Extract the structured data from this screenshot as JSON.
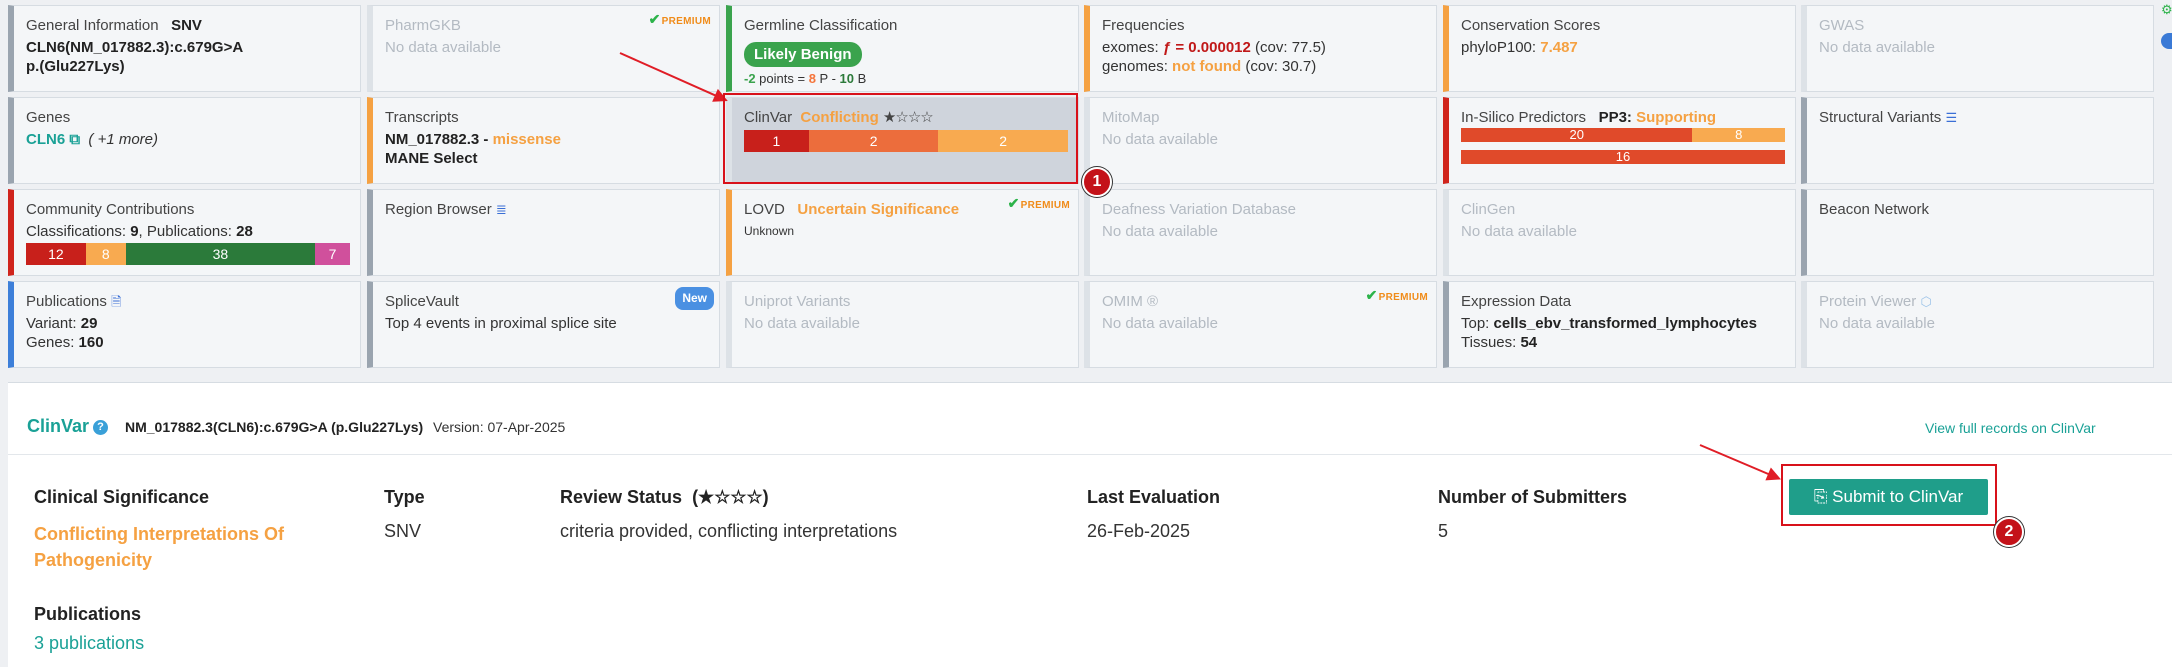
{
  "general": {
    "title": "General Information",
    "type": "SNV",
    "hgvs": "CLN6(NM_017882.3):c.679G>A",
    "protein": "p.(Glu227Lys)"
  },
  "pharmgkb": {
    "title": "PharmGKB",
    "nd": "No data available",
    "premium": "PREMIUM"
  },
  "germline": {
    "title": "Germline Classification",
    "verdict": "Likely Benign",
    "points": "-2",
    "points_label": " points = ",
    "p_val": "8",
    "p_label": " P - ",
    "b_val": "10",
    "b_label": " B"
  },
  "freq": {
    "title": "Frequencies",
    "ex_label": "exomes: ",
    "ex_f": "ƒ = 0.000012",
    "ex_cov": " (cov: 77.5)",
    "gen_label": "genomes: ",
    "gen_val": "not found",
    "gen_cov": " (cov: 30.7)"
  },
  "conservation": {
    "title": "Conservation Scores",
    "label": "phyloP100: ",
    "value": "7.487"
  },
  "gwas": {
    "title": "GWAS",
    "nd": "No data available"
  },
  "genes": {
    "title": "Genes",
    "gene": "CLN6",
    "more": "( +1 more)"
  },
  "transcripts": {
    "title": "Transcripts",
    "id": "NM_017882.3 - ",
    "effect": "missense",
    "select": "MANE Select"
  },
  "clinvar_card": {
    "title": "ClinVar",
    "status": "Conflicting",
    "stars": "★☆☆☆",
    "bars": [
      {
        "v": "1",
        "color": "#c8201b"
      },
      {
        "v": "2",
        "color": "#ec6d3c"
      },
      {
        "v": "2",
        "color": "#f8aa50"
      }
    ]
  },
  "mitomap": {
    "title": "MitoMap",
    "nd": "No data available"
  },
  "insilico": {
    "title": "In-Silico Predictors",
    "pp3": "PP3: ",
    "pp3_val": "Supporting",
    "bar1": [
      {
        "v": "20",
        "color": "#e04a2a"
      },
      {
        "v": "8",
        "color": "#f8aa50"
      }
    ],
    "bar2": [
      {
        "v": "16",
        "color": "#e04a2a"
      }
    ]
  },
  "structural": {
    "title": "Structural Variants"
  },
  "community": {
    "title": "Community Contributions",
    "class_label": "Classifications: ",
    "class_val": "9",
    "pub_label": ", Publications: ",
    "pub_val": "28",
    "bars": [
      {
        "v": "12",
        "color": "#c8201b"
      },
      {
        "v": "8",
        "color": "#f8aa50"
      },
      {
        "v": "38",
        "color": "#2b7a3a"
      },
      {
        "v": "7",
        "color": "#d0509c"
      }
    ]
  },
  "region": {
    "title": "Region Browser"
  },
  "lovd": {
    "title": "LOVD",
    "status": "Uncertain Significance",
    "sub": "Unknown",
    "premium": "PREMIUM"
  },
  "deafness": {
    "title": "Deafness Variation Database",
    "nd": "No data available"
  },
  "clingen": {
    "title": "ClinGen",
    "nd": "No data available"
  },
  "beacon": {
    "title": "Beacon Network"
  },
  "publications": {
    "title": "Publications",
    "variant_label": "Variant: ",
    "variant": "29",
    "genes_label": "Genes: ",
    "genes": "160"
  },
  "splicevault": {
    "title": "SpliceVault",
    "text": "Top 4 events in proximal splice site",
    "new": "New"
  },
  "uniprot": {
    "title": "Uniprot Variants",
    "nd": "No data available"
  },
  "omim": {
    "title": "OMIM ®",
    "nd": "No data available",
    "premium": "PREMIUM"
  },
  "expression": {
    "title": "Expression Data",
    "top_label": "Top: ",
    "top": "cells_ebv_transformed_lymphocytes",
    "tissues_label": "Tissues: ",
    "tissues": "54"
  },
  "protein": {
    "title": "Protein Viewer",
    "nd": "No data available"
  },
  "markers": {
    "one": "1",
    "two": "2"
  },
  "panel": {
    "title": "ClinVar",
    "variant": "NM_017882.3(CLN6):c.679G>A (p.Glu227Lys)",
    "version": "Version: 07-Apr-2025",
    "link": "View full records on ClinVar",
    "h_sig": "Clinical Significance",
    "h_type": "Type",
    "h_review": "Review Status",
    "h_review_stars": "(★☆☆☆)",
    "h_last": "Last Evaluation",
    "h_num": "Number of Submitters",
    "sig1": "Conflicting Interpretations Of",
    "sig2": "Pathogenicity",
    "type": "SNV",
    "review": "criteria provided, conflicting interpretations",
    "last": "26-Feb-2025",
    "num": "5",
    "pub_h": "Publications",
    "pub_link": "3 publications",
    "submit": "Submit to ClinVar"
  },
  "colors": {
    "accent": "#1aa196",
    "warn": "#f5a142",
    "danger": "#d8111a"
  }
}
